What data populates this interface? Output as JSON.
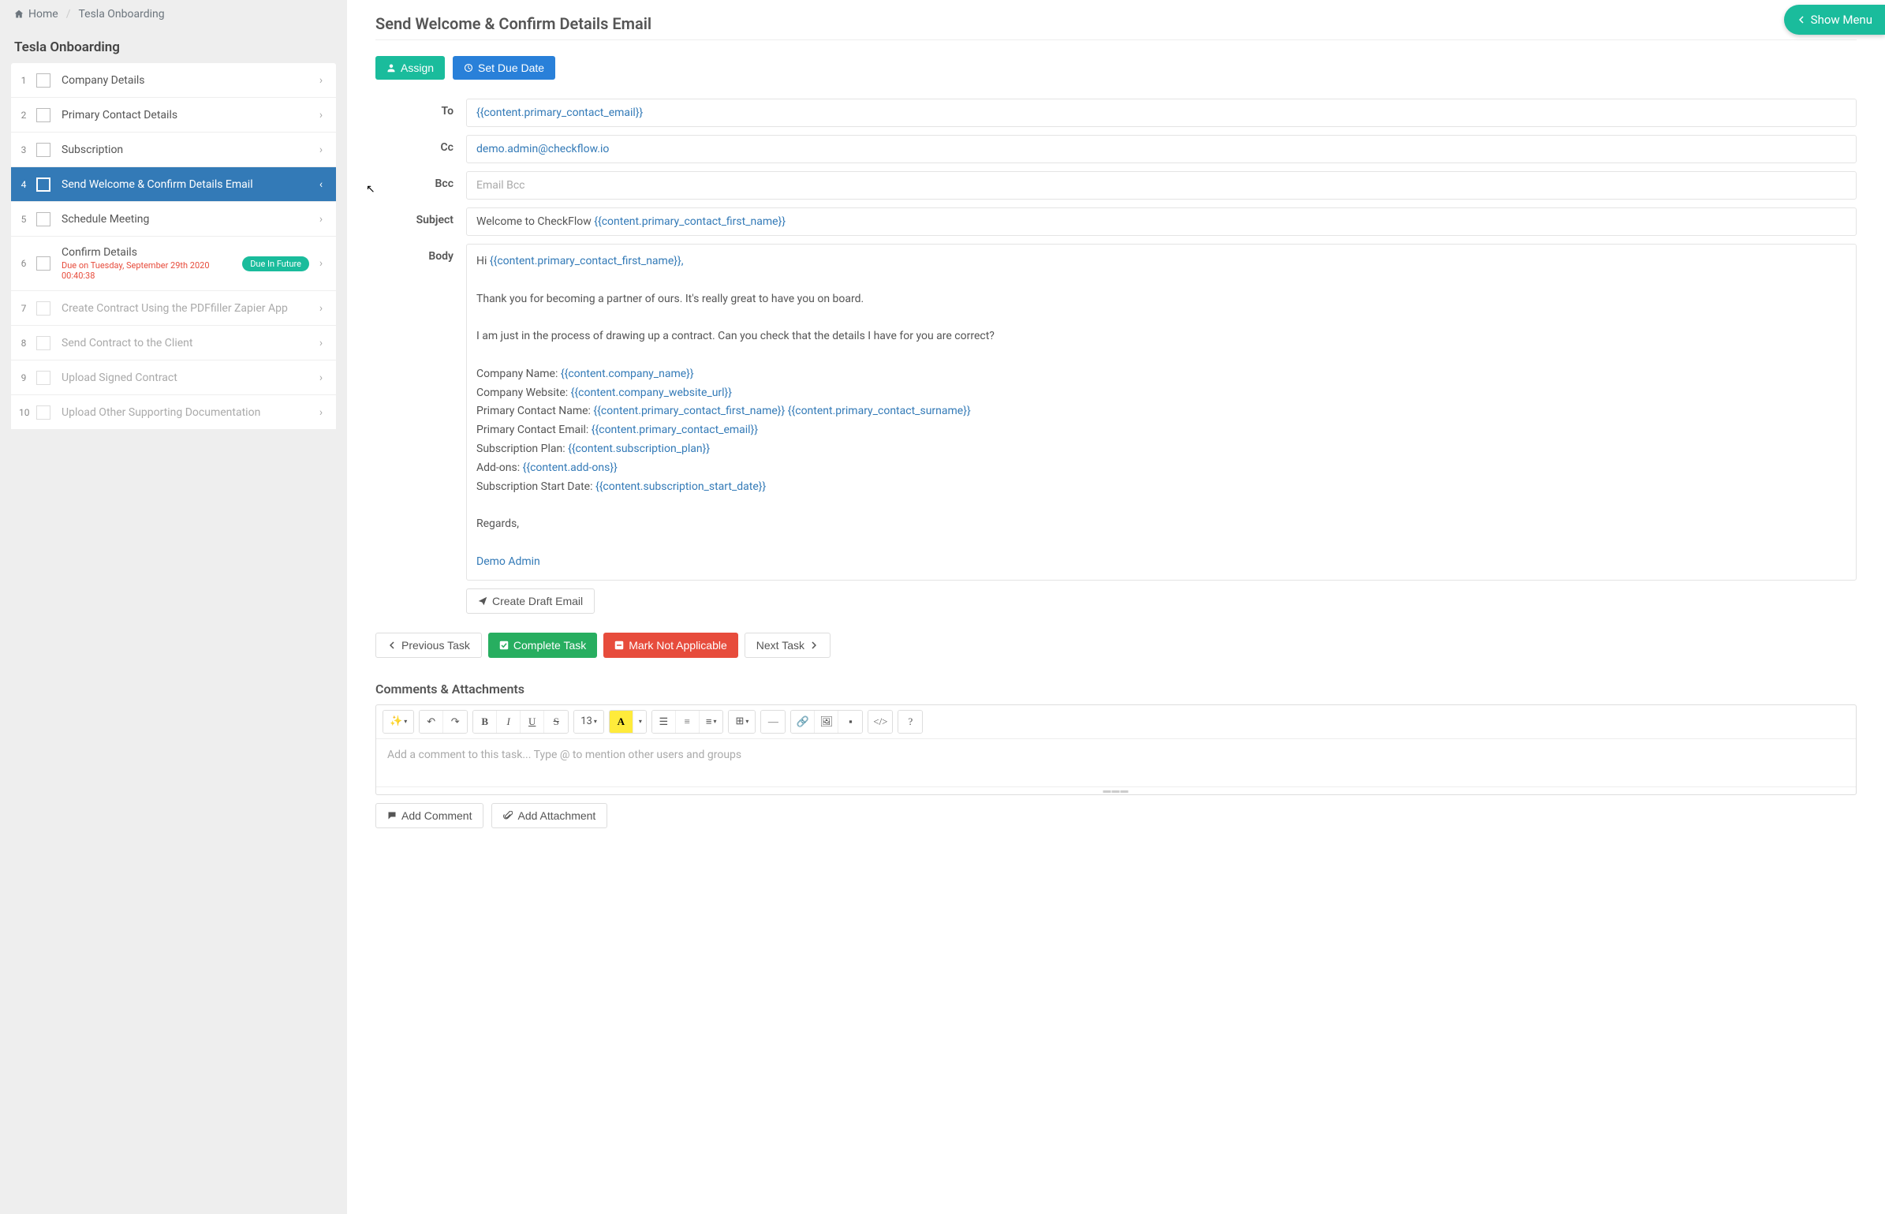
{
  "breadcrumb": {
    "home": "Home",
    "current": "Tesla Onboarding"
  },
  "sidebar": {
    "title": "Tesla Onboarding",
    "tasks": [
      {
        "num": "1",
        "label": "Company Details"
      },
      {
        "num": "2",
        "label": "Primary Contact Details"
      },
      {
        "num": "3",
        "label": "Subscription"
      },
      {
        "num": "4",
        "label": "Send Welcome & Confirm Details Email"
      },
      {
        "num": "5",
        "label": "Schedule Meeting"
      },
      {
        "num": "6",
        "label": "Confirm Details",
        "due": "Due on Tuesday, September 29th 2020 00:40:38",
        "badge": "Due In Future"
      },
      {
        "num": "7",
        "label": "Create Contract Using the PDFfiller Zapier App"
      },
      {
        "num": "8",
        "label": "Send Contract to the Client"
      },
      {
        "num": "9",
        "label": "Upload Signed Contract"
      },
      {
        "num": "10",
        "label": "Upload Other Supporting Documentation"
      }
    ]
  },
  "main": {
    "title": "Send Welcome & Confirm Details Email",
    "assign_btn": "Assign",
    "set_due_btn": "Set Due Date",
    "fields": {
      "to_label": "To",
      "to_value": "{{content.primary_contact_email}}",
      "cc_label": "Cc",
      "cc_value": "demo.admin@checkflow.io",
      "bcc_label": "Bcc",
      "bcc_placeholder": "Email Bcc",
      "subject_label": "Subject",
      "subject_prefix": "Welcome to CheckFlow ",
      "subject_token": "{{content.primary_contact_first_name}}",
      "body_label": "Body"
    },
    "body": {
      "greeting_prefix": "Hi ",
      "greeting_token": "{{content.primary_contact_first_name}}",
      "greeting_suffix": ",",
      "p1": "Thank you for becoming a partner of ours. It's really great to have you on board.",
      "p2": "I am just in the process of drawing up a contract. Can you check that the details I have for you are correct?",
      "l1_label": "Company Name: ",
      "l1_token": "{{content.company_name}}",
      "l2_label": "Company Website: ",
      "l2_token": "{{content.company_website_url}}",
      "l3_label": "Primary Contact Name: ",
      "l3_token1": "{{content.primary_contact_first_name}}",
      "l3_token2": "{{content.primary_contact_surname}}",
      "l4_label": "Primary Contact Email: ",
      "l4_token": "{{content.primary_contact_email}}",
      "l5_label": "Subscription Plan: ",
      "l5_token": "{{content.subscription_plan}}",
      "l6_label": "Add-ons: ",
      "l6_token": "{{content.add-ons}}",
      "l7_label": "Subscription Start Date: ",
      "l7_token": "{{content.subscription_start_date}}",
      "regards": "Regards,",
      "signature": "Demo Admin"
    },
    "create_draft_btn": "Create Draft Email",
    "prev_btn": "Previous Task",
    "complete_btn": "Complete Task",
    "na_btn": "Mark Not Applicable",
    "next_btn": "Next Task"
  },
  "comments": {
    "title": "Comments & Attachments",
    "placeholder": "Add a comment to this task... Type @ to mention other users and groups",
    "font_size": "13",
    "add_comment_btn": "Add Comment",
    "add_attachment_btn": "Add Attachment"
  },
  "show_menu": "Show Menu"
}
